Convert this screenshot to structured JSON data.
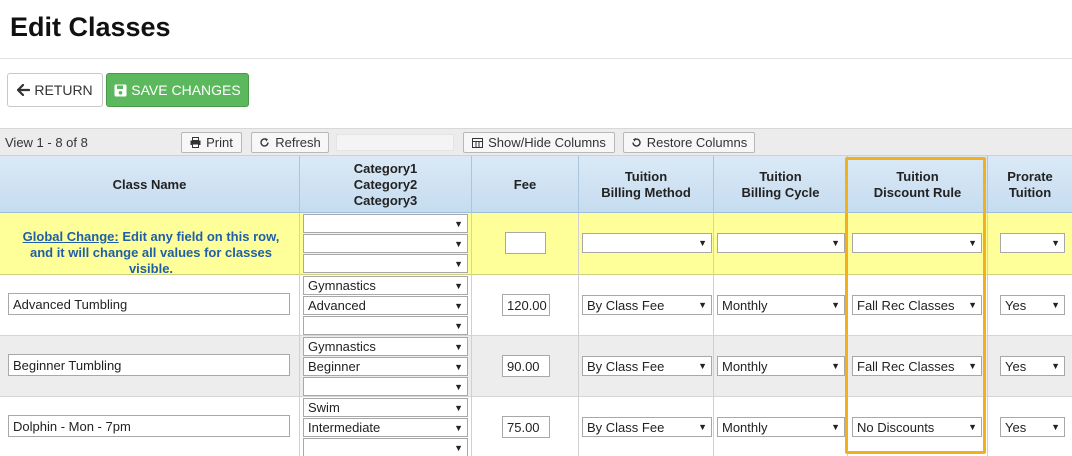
{
  "page": {
    "title": "Edit Classes"
  },
  "actions": {
    "return_label": "RETURN",
    "save_label": "SAVE CHANGES"
  },
  "toolbar": {
    "view_text": "View 1 - 8 of 8",
    "print_label": "Print",
    "refresh_label": "Refresh",
    "show_hide_label": "Show/Hide Columns",
    "restore_label": "Restore Columns"
  },
  "columns": {
    "class_name": "Class Name",
    "category1": "Category1",
    "category2": "Category2",
    "category3": "Category3",
    "fee": "Fee",
    "billing_method_1": "Tuition",
    "billing_method_2": "Billing Method",
    "billing_cycle_1": "Tuition",
    "billing_cycle_2": "Billing Cycle",
    "discount_rule_1": "Tuition",
    "discount_rule_2": "Discount Rule",
    "prorate_1": "Prorate",
    "prorate_2": "Tuition"
  },
  "global_change": {
    "link": "Global Change:",
    "text1": " Edit any field on this row,",
    "text2": "and it will change all values for classes visible."
  },
  "rows": [
    {
      "name": "Advanced Tumbling",
      "cat1": "Gymnastics",
      "cat2": "Advanced",
      "cat3": "",
      "fee": "120.00",
      "billing_method": "By Class Fee",
      "billing_cycle": "Monthly",
      "discount_rule": "Fall Rec Classes",
      "prorate": "Yes"
    },
    {
      "name": "Beginner Tumbling",
      "cat1": "Gymnastics",
      "cat2": "Beginner",
      "cat3": "",
      "fee": "90.00",
      "billing_method": "By Class Fee",
      "billing_cycle": "Monthly",
      "discount_rule": "Fall Rec Classes",
      "prorate": "Yes"
    },
    {
      "name": "Dolphin - Mon - 7pm",
      "cat1": "Swim",
      "cat2": "Intermediate",
      "cat3": "",
      "fee": "75.00",
      "billing_method": "By Class Fee",
      "billing_cycle": "Monthly",
      "discount_rule": "No Discounts",
      "prorate": "Yes"
    }
  ],
  "colors": {
    "save_green": "#5cb85c",
    "global_row": "#ffff99",
    "header_blue": "#c5dcf0",
    "highlight": "#f3b01b",
    "link_blue": "#1f5fa8"
  },
  "icons": {
    "return": "arrow-left-icon",
    "save": "floppy-disk-icon",
    "print": "printer-icon",
    "refresh": "refresh-icon",
    "show_hide": "columns-icon",
    "restore": "undo-icon",
    "dropdown": "caret-down-icon"
  }
}
